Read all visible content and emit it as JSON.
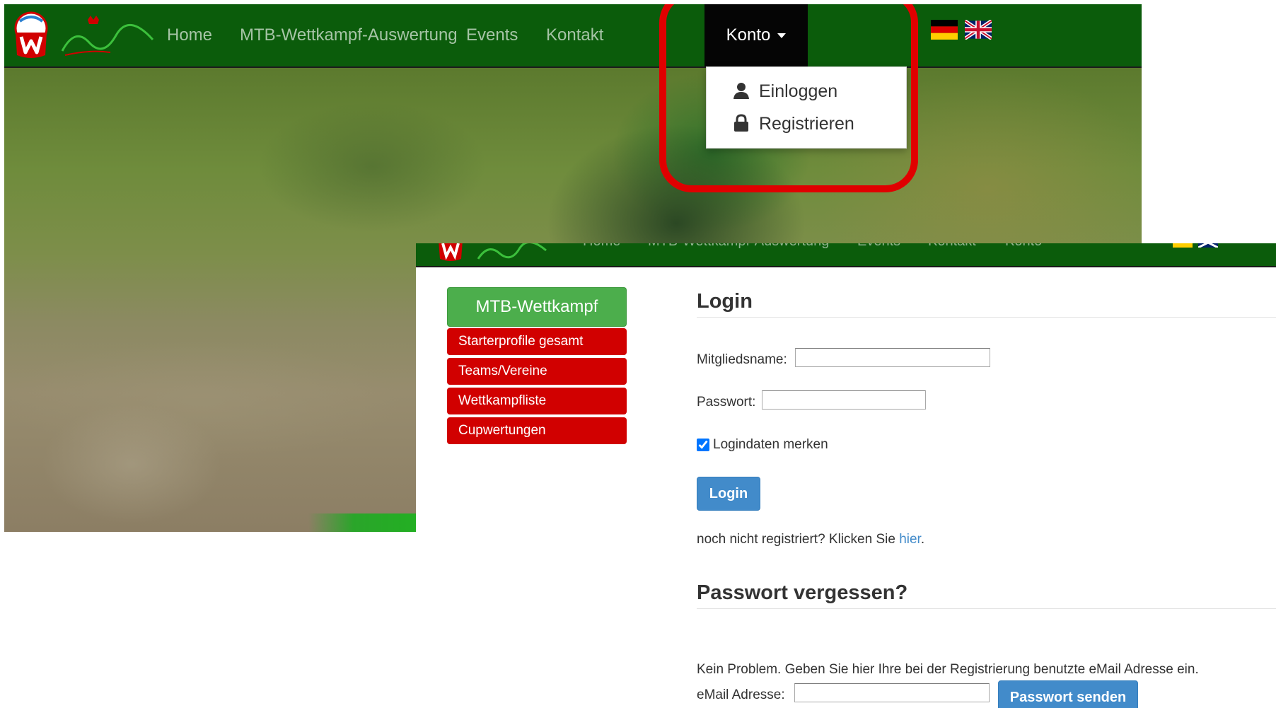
{
  "top": {
    "nav": {
      "items": [
        "Home",
        "MTB-Wettkampf-Auswertung",
        "Events",
        "Kontakt"
      ],
      "active": "Konto"
    },
    "dropdown": {
      "login": "Einloggen",
      "register": "Registrieren"
    }
  },
  "bottom": {
    "nav": {
      "items": [
        "Home",
        "MTB-Wettkampf-Auswertung",
        "Events",
        "Kontakt",
        "Konto"
      ]
    },
    "sidebar": {
      "header": "MTB-Wettkampf",
      "items": [
        "Starterprofile gesamt",
        "Teams/Vereine",
        "Wettkampfliste",
        "Cupwertungen"
      ]
    },
    "login": {
      "title": "Login",
      "member_label": "Mitgliedsname:",
      "password_label": "Passwort:",
      "member_value": "",
      "password_value": "",
      "remember_label": "Logindaten merken",
      "remember_checked": true,
      "button": "Login",
      "register_text": "noch nicht registriert? Klicken Sie ",
      "register_link": "hier",
      "register_suffix": "."
    },
    "forgot": {
      "title": "Passwort vergessen?",
      "info": "Kein Problem. Geben Sie hier Ihre bei der Registrierung benutzte eMail Adresse ein.",
      "email_label": "eMail Adresse:",
      "email_value": "",
      "button": "Passwort senden"
    }
  },
  "colors": {
    "nav_green": "#0b5c0b",
    "sidebar_green": "#4cae4c",
    "sidebar_red": "#d10000",
    "button_blue": "#428bca",
    "highlight_red": "#e00000"
  },
  "icons": {
    "dropdown_login": "user-icon",
    "dropdown_register": "lock-icon",
    "flags": [
      "german-flag-icon",
      "uk-flag-icon"
    ]
  }
}
